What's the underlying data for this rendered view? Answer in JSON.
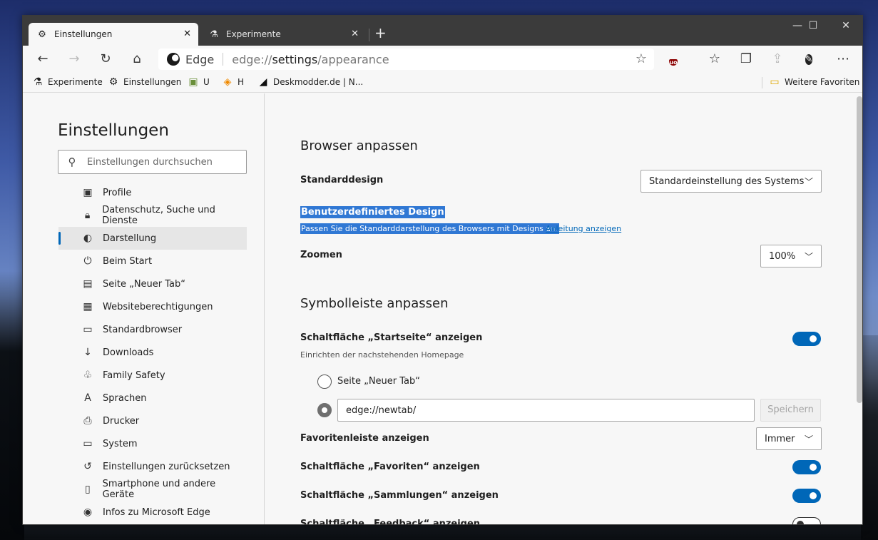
{
  "tabs": [
    {
      "label": "Einstellungen",
      "icon": "gear-icon",
      "close": "✕"
    },
    {
      "label": "Experimente",
      "icon": "flask-icon",
      "close": "✕"
    }
  ],
  "window_controls": {
    "minimize": "—",
    "maximize": "☐",
    "close": "✕"
  },
  "newtab_glyph": "+",
  "address": {
    "brand": "Edge",
    "url_prefix": "edge://",
    "url_bold": "settings",
    "url_suffix": "/appearance"
  },
  "favorites": [
    {
      "label": "Experimente",
      "icon": "flask-icon"
    },
    {
      "label": "Einstellungen",
      "icon": "gear-icon"
    },
    {
      "label": "U",
      "icon": "puzzle-icon"
    },
    {
      "label": "H",
      "icon": "cube-icon"
    },
    {
      "label": "Deskmodder.de | N...",
      "icon": "site-icon"
    },
    {
      "label": "Weitere Favoriten",
      "icon": "folder-icon"
    }
  ],
  "sidebar": {
    "title": "Einstellungen",
    "search_placeholder": "Einstellungen durchsuchen",
    "items": [
      {
        "label": "Profile",
        "icon": "profile-icon"
      },
      {
        "label": "Datenschutz, Suche und Dienste",
        "icon": "lock-icon"
      },
      {
        "label": "Darstellung",
        "icon": "palette-icon",
        "active": true
      },
      {
        "label": "Beim Start",
        "icon": "power-icon"
      },
      {
        "label": "Seite „Neuer Tab“",
        "icon": "newtab-icon"
      },
      {
        "label": "Websiteberechtigungen",
        "icon": "site-permissions-icon"
      },
      {
        "label": "Standardbrowser",
        "icon": "browser-icon"
      },
      {
        "label": "Downloads",
        "icon": "download-icon"
      },
      {
        "label": "Family Safety",
        "icon": "family-icon"
      },
      {
        "label": "Sprachen",
        "icon": "language-icon"
      },
      {
        "label": "Drucker",
        "icon": "printer-icon"
      },
      {
        "label": "System",
        "icon": "laptop-icon"
      },
      {
        "label": "Einstellungen zurücksetzen",
        "icon": "reset-icon"
      },
      {
        "label": "Smartphone und andere Geräte",
        "icon": "phone-icon"
      },
      {
        "label": "Infos zu Microsoft Edge",
        "icon": "edge-icon"
      }
    ]
  },
  "main": {
    "section1_title": "Browser anpassen",
    "default_design_label": "Standarddesign",
    "default_design_value": "Standardeinstellung des Systems",
    "custom_design_title": "Benutzerdefiniertes Design",
    "custom_design_desc": "Passen Sie die Standarddarstellung des Browsers mit Designs an.",
    "custom_design_link": "Anleitung anzeigen",
    "zoom_label": "Zoomen",
    "zoom_value": "100%",
    "section2_title": "Symbolleiste anpassen",
    "home_button_label": "Schaltfläche „Startseite“ anzeigen",
    "home_button_sub": "Einrichten der nachstehenden Homepage",
    "home_button_on": true,
    "radio_newtab_label": "Seite „Neuer Tab“",
    "radio_url_value": "edge://newtab/",
    "save_label": "Speichern",
    "favbar_label": "Favoritenleiste anzeigen",
    "favbar_value": "Immer",
    "fav_button_label": "Schaltfläche „Favoriten“ anzeigen",
    "fav_button_on": true,
    "collections_label": "Schaltfläche „Sammlungen“ anzeigen",
    "collections_on": true,
    "feedback_label": "Schaltfläche „Feedback“ anzeigen",
    "feedback_on": false
  },
  "colors": {
    "accent": "#0067b8",
    "selection": "#3078d4"
  }
}
